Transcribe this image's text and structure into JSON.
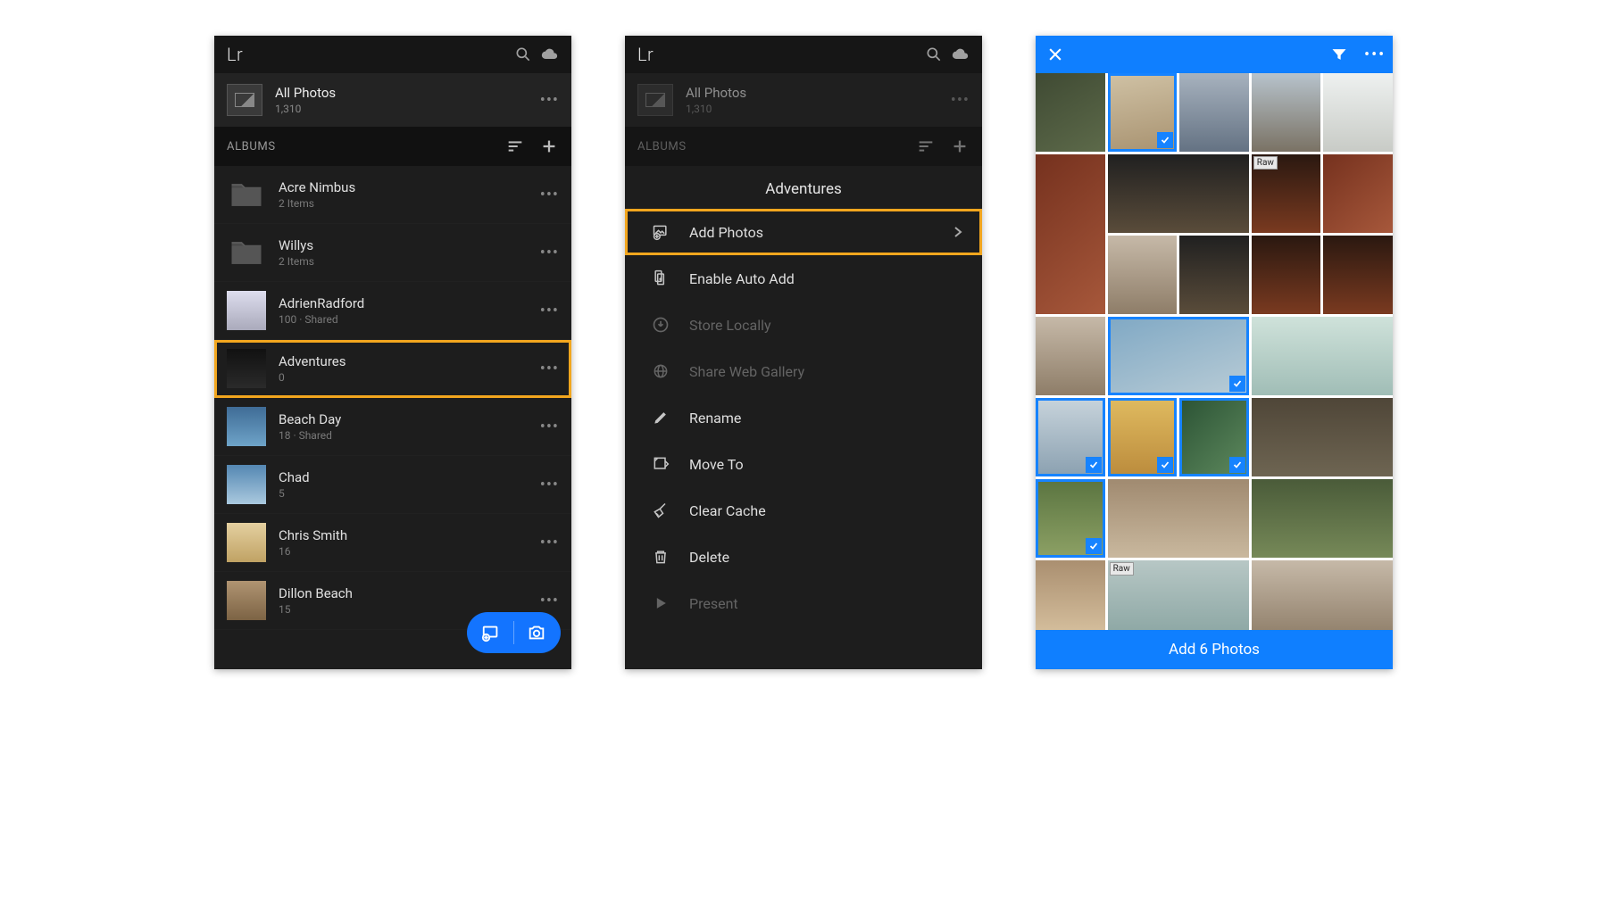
{
  "screen1": {
    "logo": "Lr",
    "allphotos": {
      "title": "All Photos",
      "count": "1,310"
    },
    "albums_label": "ALBUMS",
    "albums": [
      {
        "name": "Acre Nimbus",
        "meta": "2 Items",
        "folder": true
      },
      {
        "name": "Willys",
        "meta": "2 Items",
        "folder": true
      },
      {
        "name": "AdrienRadford",
        "meta": "100 · Shared",
        "thumbclass": "at1"
      },
      {
        "name": "Adventures",
        "meta": "0",
        "thumbclass": "at2",
        "highlight": true
      },
      {
        "name": "Beach Day",
        "meta": "18 · Shared",
        "thumbclass": "at3"
      },
      {
        "name": "Chad",
        "meta": "5",
        "thumbclass": "at4"
      },
      {
        "name": "Chris Smith",
        "meta": "16",
        "thumbclass": "at5"
      },
      {
        "name": "Dillon Beach",
        "meta": "15",
        "thumbclass": "at6"
      }
    ]
  },
  "screen2": {
    "logo": "Lr",
    "allphotos": {
      "title": "All Photos",
      "count": "1,310"
    },
    "albums_label": "ALBUMS",
    "menu_title": "Adventures",
    "menu": [
      {
        "label": "Add Photos",
        "icon": "add-photo",
        "highlight": true,
        "chevron": true
      },
      {
        "label": "Enable Auto Add",
        "icon": "auto-add"
      },
      {
        "label": "Store Locally",
        "icon": "download",
        "dimmed": true
      },
      {
        "label": "Share Web Gallery",
        "icon": "globe",
        "dimmed": true
      },
      {
        "label": "Rename",
        "icon": "pencil"
      },
      {
        "label": "Move To",
        "icon": "move"
      },
      {
        "label": "Clear Cache",
        "icon": "broom"
      },
      {
        "label": "Delete",
        "icon": "trash"
      },
      {
        "label": "Present",
        "icon": "play",
        "dimmed": true
      }
    ]
  },
  "screen3": {
    "raw_label": "Raw",
    "add_label": "Add 6 Photos",
    "tiles": [
      {
        "cls": "g1"
      },
      {
        "cls": "g2",
        "sel": true
      },
      {
        "cls": "g3"
      },
      {
        "cls": "g4"
      },
      {
        "cls": "g5"
      },
      {
        "cls": "g6"
      },
      {
        "cls": "g2",
        "span": 1
      },
      {
        "cls": "g7",
        "raw": true
      },
      {
        "cls": "g8",
        "span": 2
      },
      {
        "cls": ""
      },
      {
        "cls": "g9",
        "span": 1,
        "rowspan": 1
      },
      {
        "cls": "g10",
        "sel": true,
        "span": 2
      },
      {
        "cls": ""
      },
      {
        "cls": "g11"
      },
      {
        "cls": "g12",
        "sel": true
      },
      {
        "cls": "g13",
        "sel": true
      },
      {
        "cls": "g14",
        "sel": true
      },
      {
        "cls": "g15",
        "span": 2
      },
      {
        "cls": ""
      },
      {
        "cls": "g16",
        "sel": true
      },
      {
        "cls": "g17",
        "span": 2
      },
      {
        "cls": ""
      },
      {
        "cls": "g18"
      },
      {
        "cls": "g19"
      },
      {
        "cls": "g20",
        "raw": true,
        "span": 2
      },
      {
        "cls": ""
      },
      {
        "cls": "g9",
        "span": 2
      },
      {
        "cls": ""
      }
    ]
  }
}
